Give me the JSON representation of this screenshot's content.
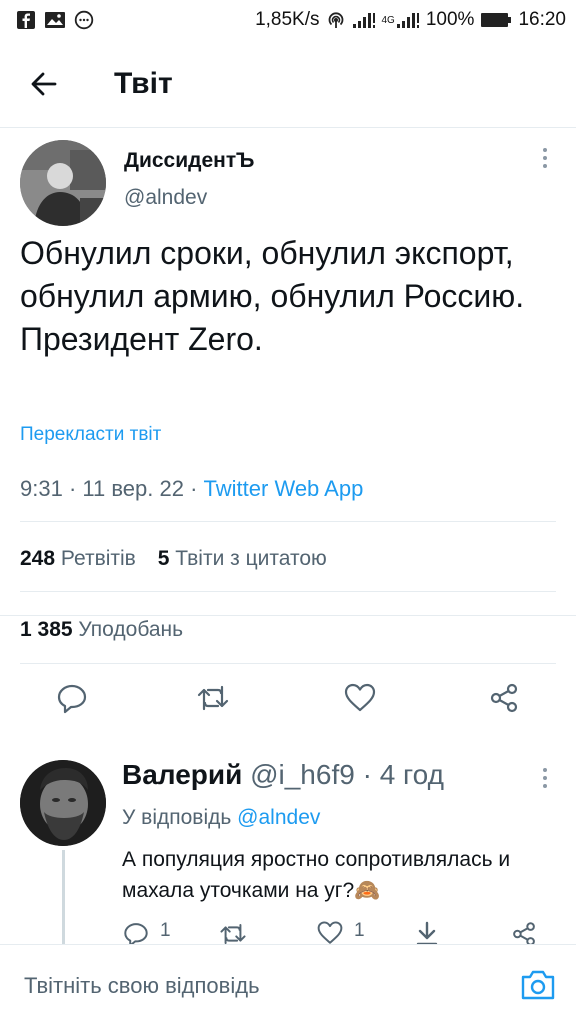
{
  "status_bar": {
    "speed": "1,85K/s",
    "network": "4G",
    "battery": "100%",
    "time": "16:20",
    "left_icons": [
      "facebook-icon",
      "gallery-icon",
      "chat-icon"
    ]
  },
  "header": {
    "title": "Твіт",
    "back_icon": "arrow-left-icon"
  },
  "tweet": {
    "author_name": "ДиссидентЪ",
    "author_handle": "@alndev",
    "text": "Обнулил сроки, обнулил экспорт, обнулил армию, обнулил Россию. Президент Zero.",
    "translate_label": "Перекласти твіт",
    "time": "9:31",
    "date": "11 вер. 22",
    "separator": "·",
    "source": "Twitter Web App",
    "retweets_count": "248",
    "retweets_label": "Ретвітів",
    "quotes_count": "5",
    "quotes_label": "Твіти з цитатою",
    "likes_count": "1 385",
    "likes_label": "Уподобань"
  },
  "reply": {
    "author_name": "Валерий",
    "author_handle": "@i_h6f9",
    "separator": "·",
    "time": "4 год",
    "replying_prefix": "У відповідь",
    "replying_to": "@alndev",
    "text": "А популяция яростно сопротивлялась и махала уточками на уг?🙈",
    "reply_count": "1",
    "like_count": "1"
  },
  "compose": {
    "placeholder": "Твітніть свою відповідь"
  },
  "colors": {
    "accent": "#1d9bf0",
    "text": "#0f1419",
    "secondary": "#536471",
    "divider": "#e6ecf0"
  }
}
